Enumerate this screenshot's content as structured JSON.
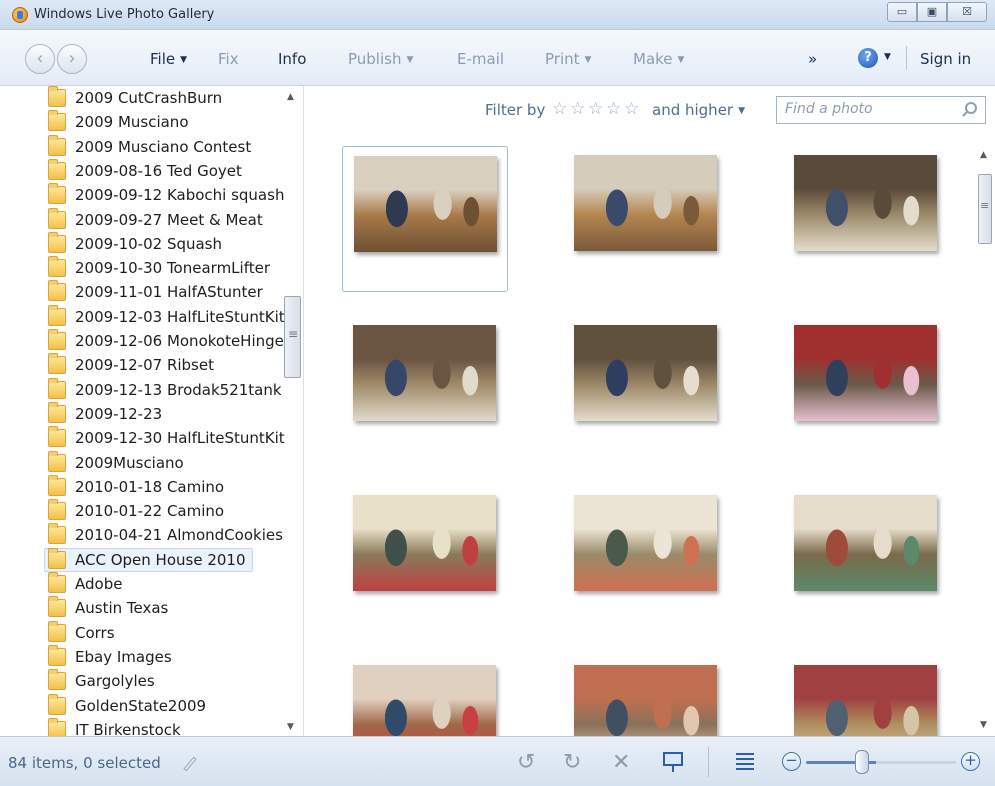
{
  "window": {
    "title": "Windows Live Photo Gallery",
    "minimize": "▭",
    "maximize": "▣",
    "close": "☒"
  },
  "menubar": {
    "back": "‹",
    "forward": "›",
    "items": [
      {
        "label": "File",
        "enabled": true,
        "dropdown": true
      },
      {
        "label": "Fix",
        "enabled": false,
        "dropdown": false
      },
      {
        "label": "Info",
        "enabled": true,
        "dropdown": false
      },
      {
        "label": "Publish",
        "enabled": false,
        "dropdown": true
      },
      {
        "label": "E-mail",
        "enabled": false,
        "dropdown": false
      },
      {
        "label": "Print",
        "enabled": false,
        "dropdown": true
      },
      {
        "label": "Make",
        "enabled": false,
        "dropdown": true
      }
    ],
    "overflow": "»",
    "help": "?",
    "sign_in": "Sign in"
  },
  "tree": {
    "folders": [
      {
        "label": "2009 CutCrashBurn",
        "selected": false
      },
      {
        "label": "2009 Musciano",
        "selected": false
      },
      {
        "label": "2009 Musciano Contest",
        "selected": false
      },
      {
        "label": "2009-08-16 Ted Goyet",
        "selected": false
      },
      {
        "label": "2009-09-12 Kabochi squash",
        "selected": false
      },
      {
        "label": "2009-09-27 Meet & Meat",
        "selected": false
      },
      {
        "label": "2009-10-02 Squash",
        "selected": false
      },
      {
        "label": "2009-10-30 TonearmLifter",
        "selected": false
      },
      {
        "label": "2009-11-01 HalfAStunter",
        "selected": false
      },
      {
        "label": "2009-12-03 HalfLiteStuntKit",
        "selected": false
      },
      {
        "label": "2009-12-06 MonokoteHinge",
        "selected": false
      },
      {
        "label": "2009-12-07 Ribset",
        "selected": false
      },
      {
        "label": "2009-12-13 Brodak521tank",
        "selected": false
      },
      {
        "label": "2009-12-23",
        "selected": false
      },
      {
        "label": "2009-12-30 HalfLiteStuntKit",
        "selected": false
      },
      {
        "label": "2009Musciano",
        "selected": false
      },
      {
        "label": "2010-01-18 Camino",
        "selected": false
      },
      {
        "label": "2010-01-22 Camino",
        "selected": false
      },
      {
        "label": "2010-04-21 AlmondCookies",
        "selected": false
      },
      {
        "label": "ACC Open House 2010",
        "selected": true
      },
      {
        "label": "Adobe",
        "selected": false
      },
      {
        "label": "Austin Texas",
        "selected": false
      },
      {
        "label": "Corrs",
        "selected": false
      },
      {
        "label": "Ebay Images",
        "selected": false
      },
      {
        "label": "Gargolyles",
        "selected": false
      },
      {
        "label": "GoldenState2009",
        "selected": false
      },
      {
        "label": "IT Birkenstock",
        "selected": false
      }
    ]
  },
  "filter": {
    "label": "Filter by",
    "stars": [
      "☆",
      "☆",
      "☆",
      "☆",
      "☆"
    ],
    "suffix": "and higher",
    "search_placeholder": "Find a photo"
  },
  "photos": [
    {
      "name": "photo-dance-class-1",
      "palette": [
        "#a87a48",
        "#6e5034",
        "#d9d0c0",
        "#2d3a52"
      ],
      "selected": true
    },
    {
      "name": "photo-dance-class-2",
      "palette": [
        "#b5864e",
        "#7a5a3a",
        "#d6ccbb",
        "#3a4a6a"
      ],
      "selected": false
    },
    {
      "name": "photo-office-1",
      "palette": [
        "#9a8a6a",
        "#e4dccb",
        "#5a4a3a",
        "#40506a"
      ],
      "selected": false
    },
    {
      "name": "photo-office-2",
      "palette": [
        "#a08a6a",
        "#e2dacb",
        "#6a5442",
        "#37476a"
      ],
      "selected": false
    },
    {
      "name": "photo-office-3",
      "palette": [
        "#9c8866",
        "#e6ddcc",
        "#60503e",
        "#2e3e5e"
      ],
      "selected": false
    },
    {
      "name": "photo-table-1",
      "palette": [
        "#6a5a4a",
        "#e8c0d0",
        "#a03030",
        "#30405a"
      ],
      "selected": false
    },
    {
      "name": "photo-craft-1",
      "palette": [
        "#8a7a5a",
        "#c04040",
        "#e8e0c8",
        "#40504a"
      ],
      "selected": false
    },
    {
      "name": "photo-craft-2",
      "palette": [
        "#9a8a6a",
        "#d07050",
        "#ece4d4",
        "#4a5a4a"
      ],
      "selected": false
    },
    {
      "name": "photo-craft-3",
      "palette": [
        "#7a6a4a",
        "#5a8a6a",
        "#e6dccc",
        "#a04a3a"
      ],
      "selected": false
    },
    {
      "name": "photo-group-1",
      "palette": [
        "#a0684a",
        "#c84040",
        "#e0d0c0",
        "#304a6a"
      ],
      "selected": false
    },
    {
      "name": "photo-group-2",
      "palette": [
        "#8a7058",
        "#e0c8b0",
        "#c07050",
        "#405060"
      ],
      "selected": false
    },
    {
      "name": "photo-group-3",
      "palette": [
        "#b09060",
        "#d4c4a8",
        "#a04040",
        "#506070"
      ],
      "selected": false
    }
  ],
  "status": {
    "summary": "84 items, 0 selected"
  },
  "toolbar": {
    "rotate_left": "↺",
    "rotate_right": "↻",
    "delete": "✕",
    "zoom_out": "−",
    "zoom_in": "+",
    "zoom_level": 0.37
  }
}
